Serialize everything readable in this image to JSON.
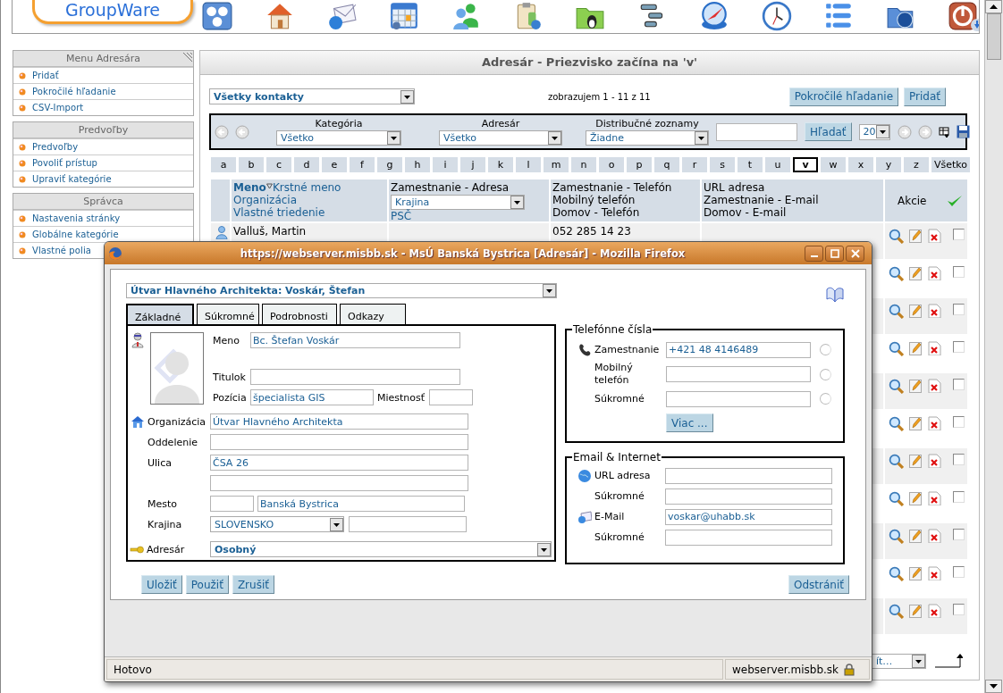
{
  "header": {
    "logo": "GroupWare"
  },
  "sidebar": [
    {
      "title": "Menu Adresára",
      "items": [
        "Pridať",
        "Pokročilé hľadanie",
        "CSV-Import"
      ]
    },
    {
      "title": "Predvoľby",
      "items": [
        "Predvoľby",
        "Povoliť prístup",
        "Upraviť kategórie"
      ]
    },
    {
      "title": "Správca",
      "items": [
        "Nastavenia stránky",
        "Globálne kategórie",
        "Vlastné polia"
      ]
    }
  ],
  "main": {
    "title": "Adresár - Priezvisko začína na 'v'",
    "contacts_filter": "Všetky kontakty",
    "count": "zobrazujem 1 - 11 z 11",
    "buttons": [
      "Pokročilé hľadanie",
      "Pridať"
    ]
  },
  "search_bar": {
    "filters": [
      {
        "label": "Kategória",
        "value": "Všetko"
      },
      {
        "label": "Adresár",
        "value": "Všetko"
      },
      {
        "label": "Distribučné zoznamy",
        "value": "Žiadne"
      }
    ],
    "search_button": "Hľadať",
    "page_size": "20"
  },
  "letters": [
    {
      "label": "a",
      "selected": false
    },
    {
      "label": "b",
      "selected": false
    },
    {
      "label": "c",
      "selected": false
    },
    {
      "label": "d",
      "selected": false
    },
    {
      "label": "e",
      "selected": false
    },
    {
      "label": "f",
      "selected": false
    },
    {
      "label": "g",
      "selected": false
    },
    {
      "label": "h",
      "selected": false
    },
    {
      "label": "i",
      "selected": false
    },
    {
      "label": "j",
      "selected": false
    },
    {
      "label": "k",
      "selected": false
    },
    {
      "label": "l",
      "selected": false
    },
    {
      "label": "m",
      "selected": false
    },
    {
      "label": "n",
      "selected": false
    },
    {
      "label": "o",
      "selected": false
    },
    {
      "label": "p",
      "selected": false
    },
    {
      "label": "q",
      "selected": false
    },
    {
      "label": "r",
      "selected": false
    },
    {
      "label": "s",
      "selected": false
    },
    {
      "label": "t",
      "selected": false
    },
    {
      "label": "u",
      "selected": false
    },
    {
      "label": "v",
      "selected": true
    },
    {
      "label": "w",
      "selected": false
    },
    {
      "label": "x",
      "selected": false
    },
    {
      "label": "y",
      "selected": false
    },
    {
      "label": "z",
      "selected": false
    },
    {
      "label": "Všetko",
      "selected": false
    }
  ],
  "table": {
    "name_column": {
      "sort_by": "Meno",
      "links": [
        "Krstné meno",
        "Organizácia",
        "Vlastné triedenie"
      ]
    },
    "address_column": {
      "title": "Zamestnanie - Adresa",
      "select": "Krajina",
      "link": "PSČ"
    },
    "phone_column": [
      "Zamestnanie - Telefón",
      "Mobilný telefón",
      "Domov - Telefón"
    ],
    "url_column": [
      "URL adresa",
      "Zamestnanie - E-mail",
      "Domov - E-mail"
    ],
    "actions_column": "Akcie",
    "rows": [
      {
        "name": "Valluš, Martin",
        "phone": "052 285 14 23",
        "checked": false
      },
      {
        "checked": false
      },
      {
        "checked": false
      },
      {
        "checked": false
      },
      {
        "checked": false
      },
      {
        "checked": false
      },
      {
        "checked": false
      },
      {
        "checked": false
      },
      {
        "checked": false
      },
      {
        "checked": false
      },
      {
        "checked": false
      }
    ]
  },
  "list_action": "ít…",
  "popup": {
    "title": "https://webserver.misbb.sk - MsÚ Banská Bystrica [Adresár] - Mozilla Firefox",
    "contact_select": "Útvar Hlavného Architekta: Voskár, Štefan",
    "tabs": [
      {
        "label": "Základné",
        "selected": true
      },
      {
        "label": "Súkromné",
        "selected": false
      },
      {
        "label": "Podrobnosti",
        "selected": false
      },
      {
        "label": "Odkazy",
        "selected": false
      }
    ],
    "name": {
      "label": "Meno",
      "value": "Bc. Štefan Voskár"
    },
    "title_field": {
      "label": "Titulok"
    },
    "position": {
      "label": "Pozícia",
      "value": "špecialista GIS"
    },
    "room": {
      "label": "Miestnosť"
    },
    "organization": {
      "label": "Organizácia",
      "value": "Útvar Hlavného Architekta"
    },
    "department": {
      "label": "Oddelenie"
    },
    "street": {
      "label": "Ulica",
      "value": "ČSA 26"
    },
    "city": {
      "label": "Mesto",
      "value": "Banská Bystrica"
    },
    "country": {
      "label": "Krajina",
      "value": "SLOVENSKO"
    },
    "addressbook": {
      "label": "Adresár",
      "value": "Osobný"
    },
    "phones": {
      "title": "Telefónne čísla",
      "fields": [
        {
          "label": "Zamestnanie",
          "value": "+421 48 4146489",
          "selected": false
        },
        {
          "label": "Mobilný telefón",
          "selected": false
        },
        {
          "label": "Súkromné",
          "selected": false
        }
      ],
      "more_button": "Viac ..."
    },
    "email": {
      "title": "Email & Internet",
      "fields": [
        {
          "label": "URL adresa",
          "kind": "url"
        },
        {
          "label": "Súkromné",
          "kind": "plain"
        },
        {
          "label": "E-Mail",
          "value": "voskar@uhabb.sk",
          "kind": "email"
        },
        {
          "label": "Súkromné",
          "kind": "plain"
        }
      ]
    },
    "buttons": [
      "Uložiť",
      "Použiť",
      "Zrušiť"
    ],
    "delete_button": "Odstrániť",
    "status": "Hotovo",
    "host": "webserver.misbb.sk"
  }
}
